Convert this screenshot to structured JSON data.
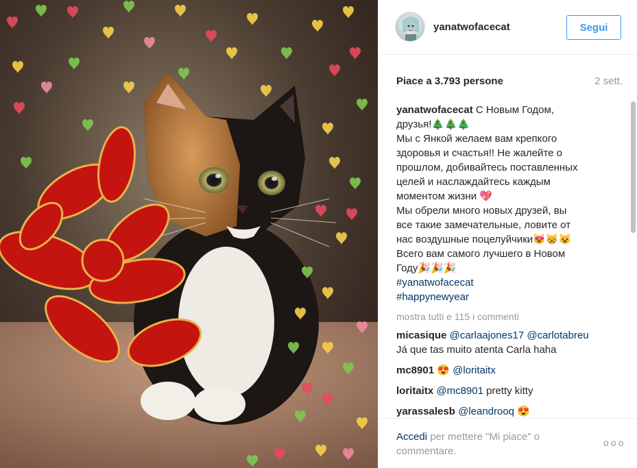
{
  "header": {
    "username": "yanatwofacecat",
    "follow_label": "Segui"
  },
  "stats": {
    "likes": "Piace a 3.793 persone",
    "time": "2 sett."
  },
  "caption": {
    "username": "yanatwofacecat",
    "text": " С Новым Годом,\nдрузья!🎄🎄🎄\nМы с Янкой желаем вам крепкого\nздоровья и счастья!! Не жалейте о\nпрошлом, добивайтесь поставленных\nцелей и наслаждайтесь каждым\nмоментом жизни 💖\nМы обрели много новых друзей, вы\nвсе такие замечательные, ловите от\nнас воздушные поцелуйчики😻😸😺\nВсего вам самого лучшего в Новом\nГоду🎉🎉🎉",
    "hashtags": [
      "#yanatwofacecat",
      "#happynewyear"
    ]
  },
  "show_all": "mostra tutti e 115 i commenti",
  "comments": [
    {
      "user": "micasique",
      "mention1": "@carlaajones17",
      "mention2": "@carlotabreu",
      "text": "Já que tas muito atenta Carla haha"
    },
    {
      "user": "mc8901",
      "emoji": "😍",
      "mention1": "@loritaitx"
    },
    {
      "user": "loritaitx",
      "mention1": "@mc8901",
      "text": " pretty kitty"
    },
    {
      "user": "yarassalesb",
      "mention1": "@leandrooq",
      "emoji": " 😍"
    }
  ],
  "footer": {
    "login_link": "Accedi",
    "rest": " per mettere \"Mi piace\" o commentare.",
    "more": "ooo"
  },
  "colors": {
    "accent": "#3897f0",
    "link": "#003569",
    "muted": "#999999"
  }
}
